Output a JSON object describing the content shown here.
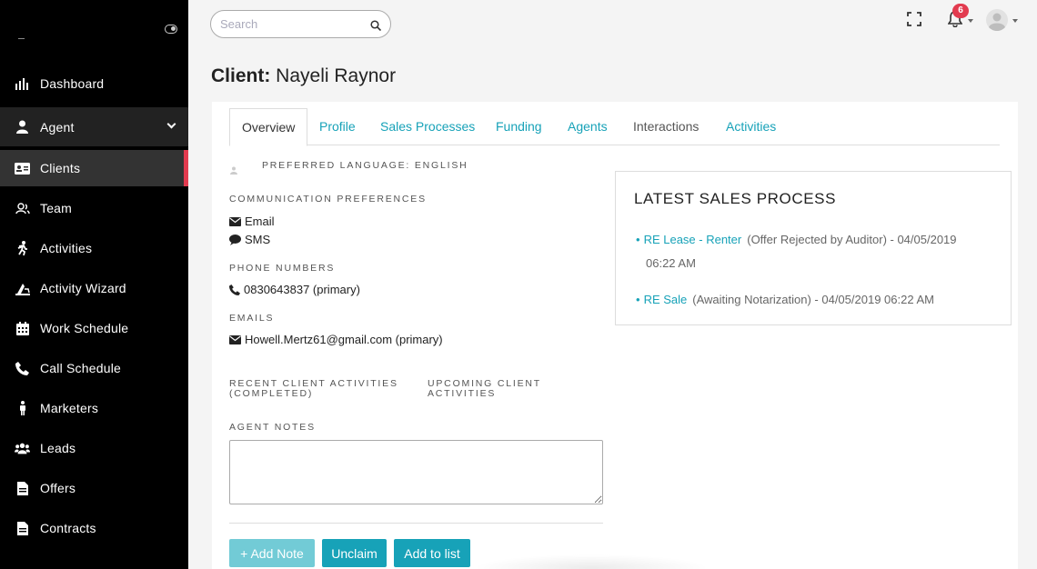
{
  "sidebar": {
    "items": [
      {
        "label": "Dashboard",
        "icon": "bar-chart-icon"
      },
      {
        "label": "Agent",
        "icon": "user-icon"
      },
      {
        "label": "Clients",
        "icon": "id-card-icon"
      },
      {
        "label": "Team",
        "icon": "users-icon"
      },
      {
        "label": "Activities",
        "icon": "running-icon"
      },
      {
        "label": "Activity Wizard",
        "icon": "wizard-icon"
      },
      {
        "label": "Work Schedule",
        "icon": "calendar-icon"
      },
      {
        "label": "Call Schedule",
        "icon": "phone-icon"
      },
      {
        "label": "Marketers",
        "icon": "person-icon"
      },
      {
        "label": "Leads",
        "icon": "group-icon"
      },
      {
        "label": "Offers",
        "icon": "file-icon"
      },
      {
        "label": "Contracts",
        "icon": "file-icon"
      }
    ],
    "active": "Clients"
  },
  "topbar": {
    "search_placeholder": "Search",
    "notification_count": "6"
  },
  "page": {
    "title_prefix": "Client:",
    "title_name": "Nayeli Raynor"
  },
  "tabs": [
    "Overview",
    "Profile",
    "Sales Processes",
    "Funding",
    "Agents",
    "Interactions",
    "Activities"
  ],
  "overview": {
    "preferred_language": "PREFERRED LANGUAGE: ENGLISH",
    "communication_label": "COMMUNICATION PREFERENCES",
    "comm_email": "Email",
    "comm_sms": "SMS",
    "phone_label": "PHONE NUMBERS",
    "phone": "0830643837 (primary)",
    "emails_label": "EMAILS",
    "email": "Howell.Mertz61@gmail.com (primary)",
    "recent_label_1": "RECENT CLIENT ACTIVITIES",
    "recent_label_2": "(COMPLETED)",
    "upcoming_label_1": "UPCOMING CLIENT",
    "upcoming_label_2": "ACTIVITIES",
    "notes_label": "AGENT NOTES"
  },
  "buttons": {
    "add_note": "+ Add Note",
    "unclaim": "Unclaim",
    "add_to_list": "Add to list"
  },
  "sales_panel": {
    "title": "LATEST SALES PROCESS",
    "items": [
      {
        "link": "RE Lease - Renter",
        "status": "(Offer Rejected by Auditor) - 04/05/2019",
        "time": "06:22 AM"
      },
      {
        "link": "RE Sale",
        "status": "(Awaiting Notarization) - 04/05/2019 06:22 AM"
      }
    ]
  },
  "colors": {
    "accent": "#17a2b8",
    "sidebar_bg": "#000000",
    "active_marker": "#e23b4f",
    "badge": "#e23b4f"
  }
}
